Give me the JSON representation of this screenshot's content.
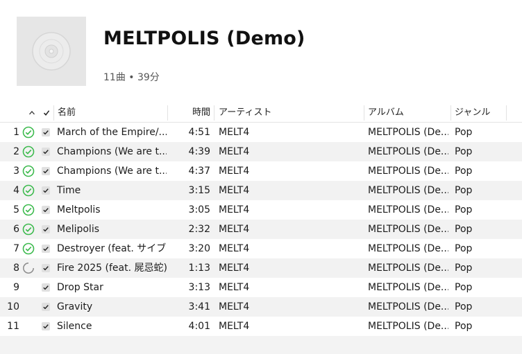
{
  "album": {
    "title": "MELTPOLIS (Demo)",
    "meta": "11曲 • 39分"
  },
  "columns": {
    "name": "名前",
    "time": "時間",
    "artist": "アーティスト",
    "album": "アルバム",
    "genre": "ジャンル"
  },
  "colors": {
    "downloaded": "#3dba4e",
    "pending": "#8a8a8a",
    "row_alt": "#f2f2f2"
  },
  "tracks": [
    {
      "num": "1",
      "status": "downloaded",
      "name": "March of the Empire/...",
      "time": "4:51",
      "artist": "MELT4",
      "album": "MELTPOLIS (De...",
      "genre": "Pop"
    },
    {
      "num": "2",
      "status": "downloaded",
      "name": "Champions (We are t...",
      "time": "4:39",
      "artist": "MELT4",
      "album": "MELTPOLIS (De...",
      "genre": "Pop"
    },
    {
      "num": "3",
      "status": "downloaded",
      "name": "Champions (We are t...",
      "time": "4:37",
      "artist": "MELT4",
      "album": "MELTPOLIS (De...",
      "genre": "Pop"
    },
    {
      "num": "4",
      "status": "downloaded",
      "name": "Time",
      "time": "3:15",
      "artist": "MELT4",
      "album": "MELTPOLIS (De...",
      "genre": "Pop"
    },
    {
      "num": "5",
      "status": "downloaded",
      "name": "Meltpolis",
      "time": "3:05",
      "artist": "MELT4",
      "album": "MELTPOLIS (De...",
      "genre": "Pop"
    },
    {
      "num": "6",
      "status": "downloaded",
      "name": "Melipolis",
      "time": "2:32",
      "artist": "MELT4",
      "album": "MELTPOLIS (De...",
      "genre": "Pop"
    },
    {
      "num": "7",
      "status": "downloaded",
      "name": "Destroyer (feat. サイブ...",
      "time": "3:20",
      "artist": "MELT4",
      "album": "MELTPOLIS (De...",
      "genre": "Pop"
    },
    {
      "num": "8",
      "status": "loading",
      "name": "Fire 2025 (feat. 屍忌蛇)",
      "time": "1:13",
      "artist": "MELT4",
      "album": "MELTPOLIS (De...",
      "genre": "Pop"
    },
    {
      "num": "9",
      "status": "none",
      "name": "Drop Star",
      "time": "3:13",
      "artist": "MELT4",
      "album": "MELTPOLIS (De...",
      "genre": "Pop"
    },
    {
      "num": "10",
      "status": "none",
      "name": "Gravity",
      "time": "3:41",
      "artist": "MELT4",
      "album": "MELTPOLIS (De...",
      "genre": "Pop"
    },
    {
      "num": "11",
      "status": "none",
      "name": "Silence",
      "time": "4:01",
      "artist": "MELT4",
      "album": "MELTPOLIS (De...",
      "genre": "Pop"
    }
  ]
}
